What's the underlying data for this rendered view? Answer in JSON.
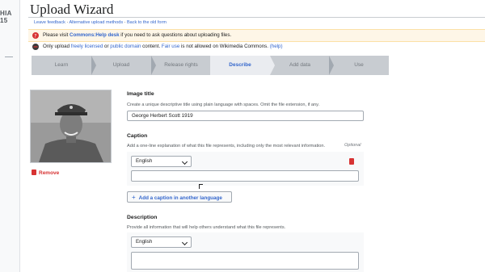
{
  "sidebar": {
    "logo_text": "HIA\n15"
  },
  "page": {
    "title": "Upload Wizard",
    "links": [
      "Leave feedback",
      "Alternative upload methods",
      "Back to the old form"
    ]
  },
  "notices": {
    "help": {
      "prefix": "Please visit ",
      "link": "Commons:Help desk",
      "suffix": " if you need to ask questions about uploading files."
    },
    "license": {
      "prefix": "Only upload ",
      "link1": "freely licensed",
      "mid1": " or ",
      "link2": "public domain",
      "mid2": " content. ",
      "link3": "Fair use",
      "suffix": " is not allowed on Wikimedia Commons. ",
      "link4": "(help)"
    }
  },
  "steps": [
    "Learn",
    "Upload",
    "Release rights",
    "Describe",
    "Add data",
    "Use"
  ],
  "active_step": "Describe",
  "image": {
    "remove_label": "Remove"
  },
  "form": {
    "image_title": {
      "label": "Image title",
      "help": "Create a unique descriptive title using plain language with spaces. Omit the file extension, if any.",
      "value": "George Herbert Scott 1919"
    },
    "caption": {
      "label": "Caption",
      "help": "Add a one-line explanation of what this file represents, including only the most relevant information.",
      "optional": "Optional",
      "language": "English",
      "value": "",
      "add_button": "Add a caption in another language"
    },
    "description": {
      "label": "Description",
      "help": "Provide all information that will help others understand what this file represents.",
      "language": "English",
      "value": ""
    }
  },
  "colors": {
    "accent": "#3366cc",
    "danger": "#d73333",
    "notice_bg": "#fef6e7",
    "step_bar": "#c8ccd1"
  }
}
